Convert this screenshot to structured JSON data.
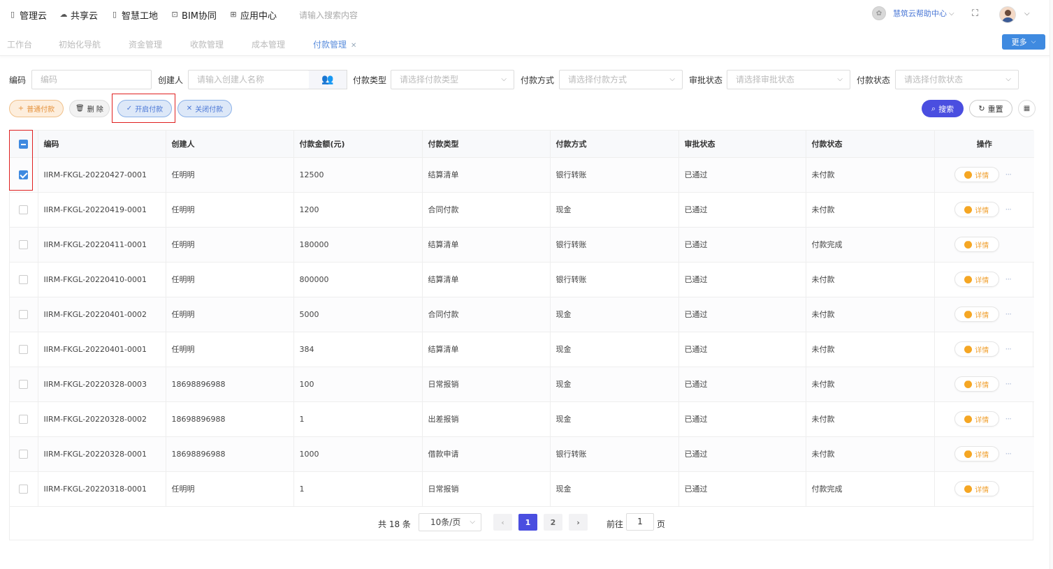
{
  "topnav": {
    "items": [
      {
        "label": "管理云",
        "icon": "square-icon"
      },
      {
        "label": "共享云",
        "icon": "cloud-icon"
      },
      {
        "label": "智慧工地",
        "icon": "square-icon"
      },
      {
        "label": "BIM协同",
        "icon": "folder-icon"
      },
      {
        "label": "应用中心",
        "icon": "grid-icon"
      }
    ],
    "search_placeholder": "请输入搜索内容",
    "help_label": "慧筑云帮助中心"
  },
  "tabs": [
    {
      "label": "工作台"
    },
    {
      "label": "初始化导航"
    },
    {
      "label": "资金管理"
    },
    {
      "label": "收款管理"
    },
    {
      "label": "成本管理"
    },
    {
      "label": "付款管理",
      "active": true
    }
  ],
  "more_label": "更多",
  "filters": {
    "code_label": "编码",
    "code_placeholder": "编码",
    "creator_label": "创建人",
    "creator_placeholder": "请输入创建人名称",
    "pay_type_label": "付款类型",
    "pay_type_placeholder": "请选择付款类型",
    "pay_method_label": "付款方式",
    "pay_method_placeholder": "请选择付款方式",
    "approval_label": "审批状态",
    "approval_placeholder": "请选择审批状态",
    "pay_status_label": "付款状态",
    "pay_status_placeholder": "请选择付款状态"
  },
  "actions": {
    "normal_pay": "普通付款",
    "delete": "删 除",
    "open_pay": "开启付款",
    "close_pay": "关闭付款",
    "search": "搜索",
    "reset": "重置"
  },
  "table": {
    "columns": [
      "编码",
      "创建人",
      "付款金额(元)",
      "付款类型",
      "付款方式",
      "审批状态",
      "付款状态",
      "操作"
    ],
    "detail_label": "详情",
    "rows": [
      {
        "code": "IIRM-FKGL-20220427-0001",
        "creator": "任明明",
        "amount": "12500",
        "type": "结算清单",
        "method": "银行转账",
        "approval": "已通过",
        "status": "未付款",
        "checked": true,
        "more": true
      },
      {
        "code": "IIRM-FKGL-20220419-0001",
        "creator": "任明明",
        "amount": "1200",
        "type": "合同付款",
        "method": "现金",
        "approval": "已通过",
        "status": "未付款",
        "checked": false,
        "more": true
      },
      {
        "code": "IIRM-FKGL-20220411-0001",
        "creator": "任明明",
        "amount": "180000",
        "type": "结算清单",
        "method": "银行转账",
        "approval": "已通过",
        "status": "付款完成",
        "checked": false,
        "more": false
      },
      {
        "code": "IIRM-FKGL-20220410-0001",
        "creator": "任明明",
        "amount": "800000",
        "type": "结算清单",
        "method": "银行转账",
        "approval": "已通过",
        "status": "未付款",
        "checked": false,
        "more": true
      },
      {
        "code": "IIRM-FKGL-20220401-0002",
        "creator": "任明明",
        "amount": "5000",
        "type": "合同付款",
        "method": "现金",
        "approval": "已通过",
        "status": "未付款",
        "checked": false,
        "more": true
      },
      {
        "code": "IIRM-FKGL-20220401-0001",
        "creator": "任明明",
        "amount": "384",
        "type": "结算清单",
        "method": "现金",
        "approval": "已通过",
        "status": "未付款",
        "checked": false,
        "more": true
      },
      {
        "code": "IIRM-FKGL-20220328-0003",
        "creator": "18698896988",
        "amount": "100",
        "type": "日常报销",
        "method": "现金",
        "approval": "已通过",
        "status": "未付款",
        "checked": false,
        "more": true
      },
      {
        "code": "IIRM-FKGL-20220328-0002",
        "creator": "18698896988",
        "amount": "1",
        "type": "出差报销",
        "method": "现金",
        "approval": "已通过",
        "status": "未付款",
        "checked": false,
        "more": true
      },
      {
        "code": "IIRM-FKGL-20220328-0001",
        "creator": "18698896988",
        "amount": "1000",
        "type": "借款申请",
        "method": "银行转账",
        "approval": "已通过",
        "status": "未付款",
        "checked": false,
        "more": true
      },
      {
        "code": "IIRM-FKGL-20220318-0001",
        "creator": "任明明",
        "amount": "1",
        "type": "日常报销",
        "method": "现金",
        "approval": "已通过",
        "status": "付款完成",
        "checked": false,
        "more": false
      }
    ]
  },
  "pagination": {
    "total": "共 18 条",
    "page_size": "10条/页",
    "pages": [
      "1",
      "2"
    ],
    "current": "1",
    "goto_label": "前往",
    "goto_value": "1",
    "page_suffix": "页"
  }
}
